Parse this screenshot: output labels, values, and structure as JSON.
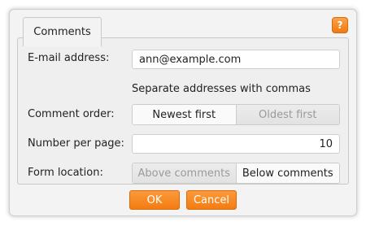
{
  "dialog": {
    "tab_label": "Comments",
    "help_label": "?"
  },
  "form": {
    "email": {
      "label": "E-mail address:",
      "value": "ann@example.com",
      "hint": "Separate addresses with commas"
    },
    "comment_order": {
      "label": "Comment order:",
      "options": [
        "Newest first",
        "Oldest first"
      ],
      "selected": "Newest first"
    },
    "per_page": {
      "label": "Number per page:",
      "value": "10"
    },
    "form_location": {
      "label": "Form location:",
      "options": [
        "Above comments",
        "Below comments"
      ],
      "selected": "Below comments"
    }
  },
  "buttons": {
    "ok": "OK",
    "cancel": "Cancel"
  },
  "colors": {
    "accent": "#f47c12",
    "panel_bg": "#efefef"
  }
}
